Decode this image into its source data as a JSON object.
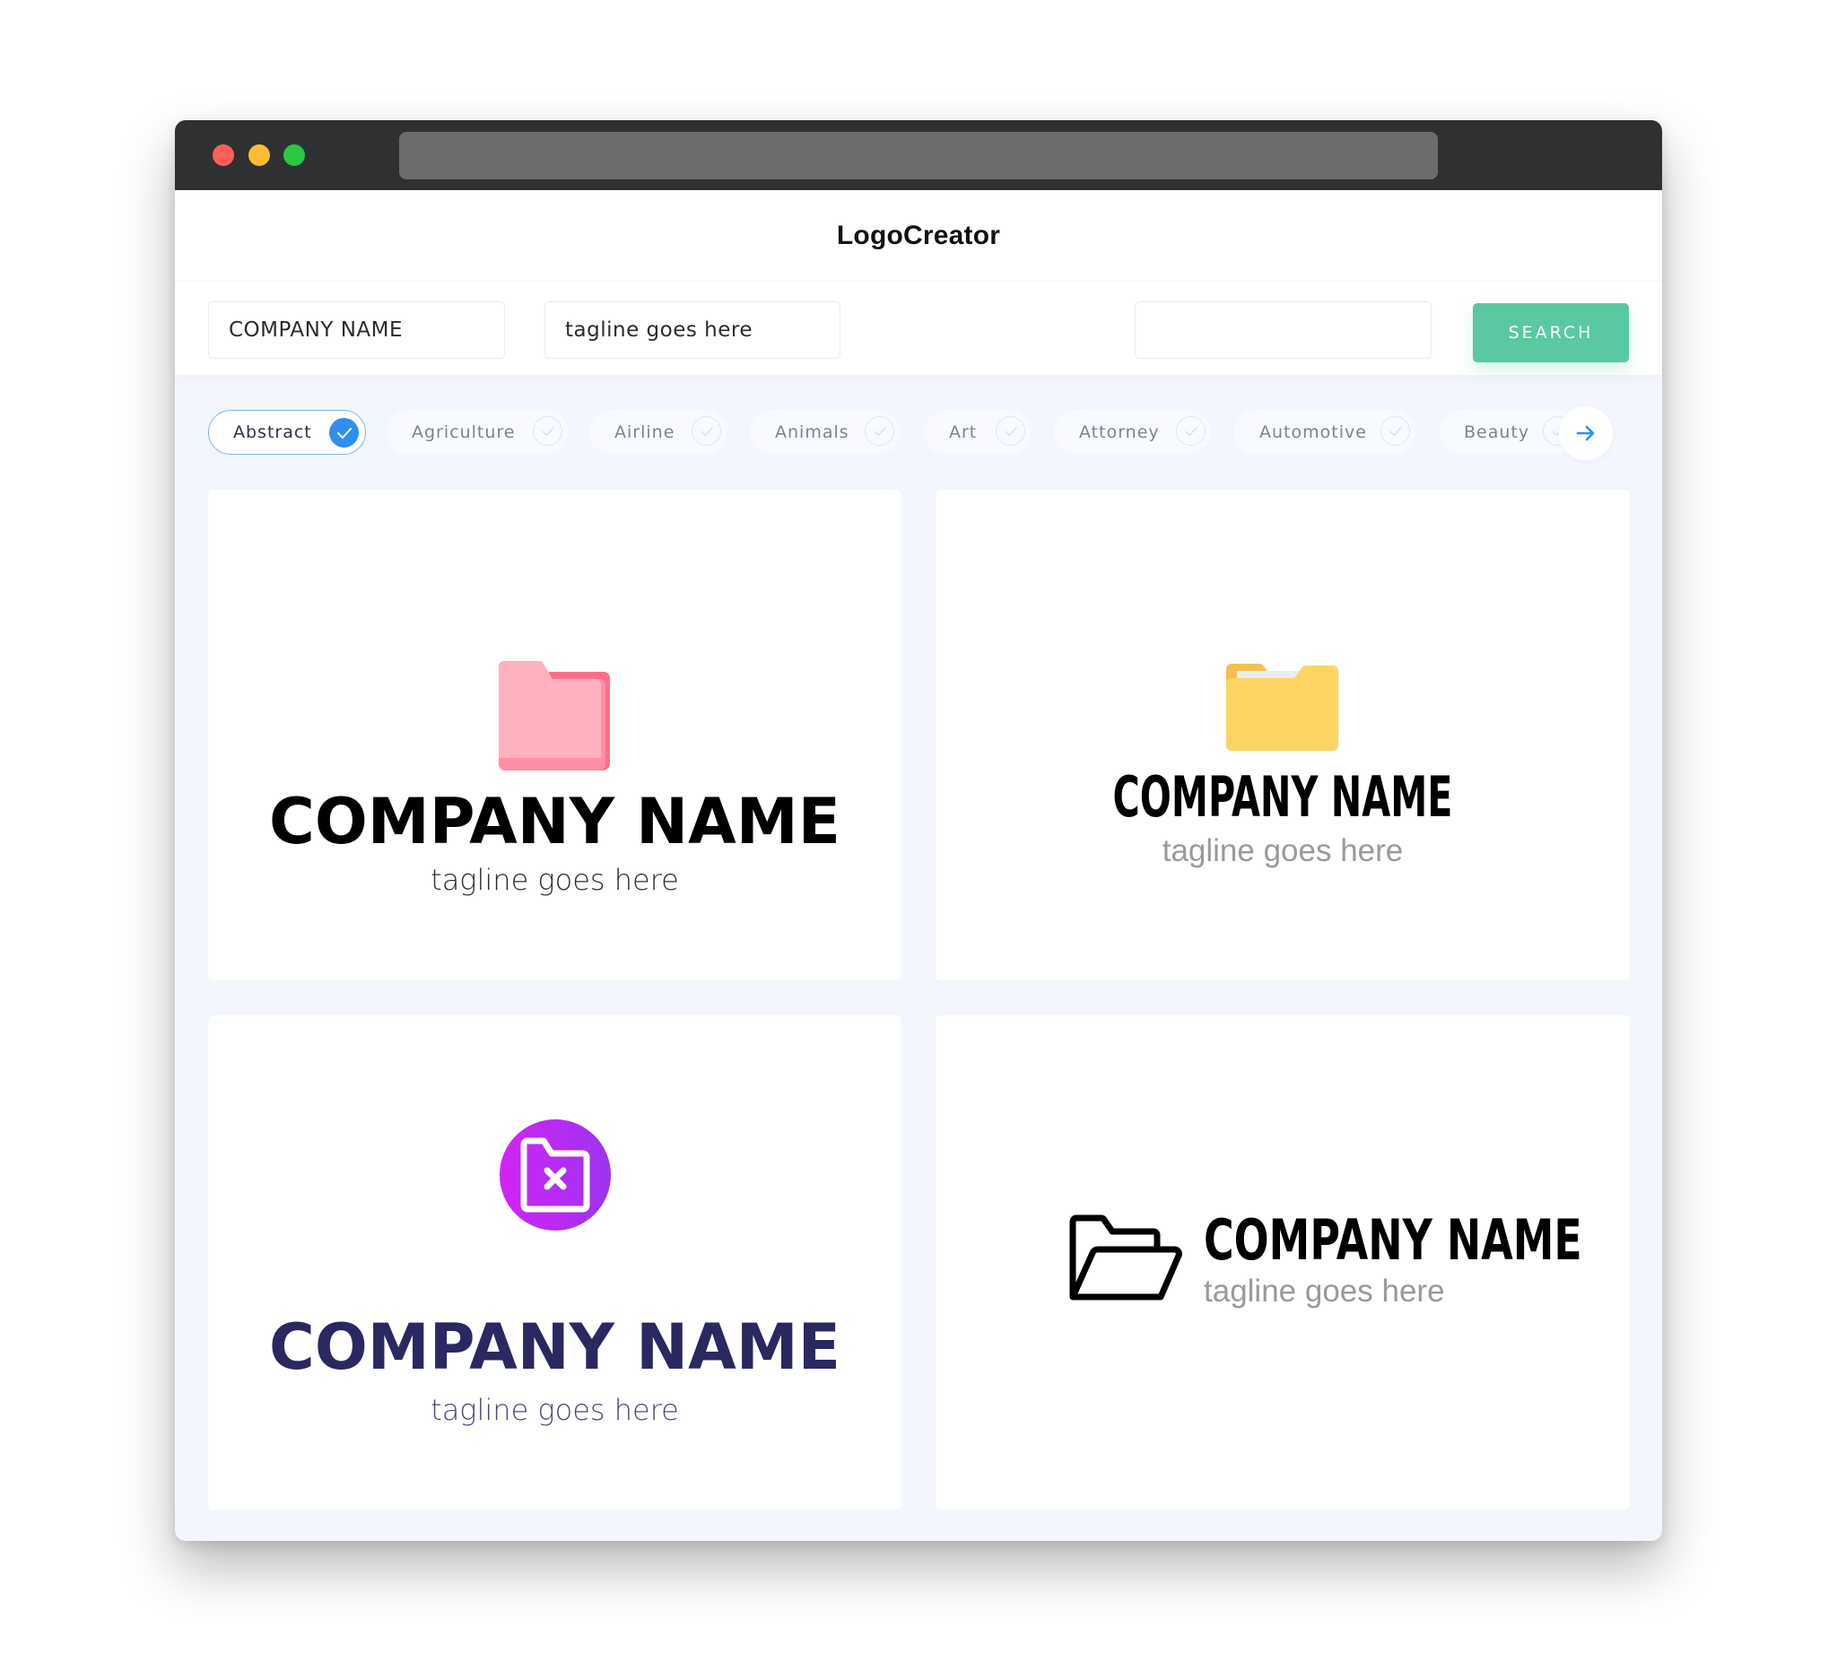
{
  "app": {
    "title": "LogoCreator"
  },
  "window": {
    "controls": [
      "close",
      "minimize",
      "maximize"
    ]
  },
  "toolbar": {
    "company_name_value": "COMPANY NAME",
    "tagline_value": "tagline goes here",
    "search_value": "",
    "search_button_label": "SEARCH"
  },
  "categories": {
    "items": [
      {
        "label": "Abstract",
        "selected": true
      },
      {
        "label": "Agriculture",
        "selected": false
      },
      {
        "label": "Airline",
        "selected": false
      },
      {
        "label": "Animals",
        "selected": false
      },
      {
        "label": "Art",
        "selected": false
      },
      {
        "label": "Attorney",
        "selected": false
      },
      {
        "label": "Automotive",
        "selected": false
      },
      {
        "label": "Beauty",
        "selected": false
      }
    ],
    "next_icon": "arrow-right-icon"
  },
  "logos": [
    {
      "icon": "folder-icon",
      "icon_color": "#ffb0bf",
      "company_name": "COMPANY NAME",
      "tagline": "tagline goes here",
      "name_color": "#000000",
      "tagline_color": "#2c2c2c"
    },
    {
      "icon": "folder-with-paper-icon",
      "icon_color": "#fbd462",
      "company_name": "COMPANY NAME",
      "tagline": "tagline goes here",
      "name_color": "#000000",
      "tagline_color": "#9a9a9a"
    },
    {
      "icon": "folder-remove-icon",
      "icon_color": "#c22cf2",
      "company_name": "COMPANY NAME",
      "tagline": "tagline goes here",
      "name_color": "#2a2860",
      "tagline_color": "#4a4878"
    },
    {
      "icon": "open-folder-icon",
      "icon_color": "#000000",
      "company_name": "COMPANY NAME",
      "tagline": "tagline goes here",
      "name_color": "#000000",
      "tagline_color": "#9a9a9a"
    }
  ],
  "colors": {
    "accent": "#2f8ff0",
    "search_button": "#5ac8a0",
    "titlebar": "#2f3032",
    "page_background": "#f3f6fc"
  }
}
